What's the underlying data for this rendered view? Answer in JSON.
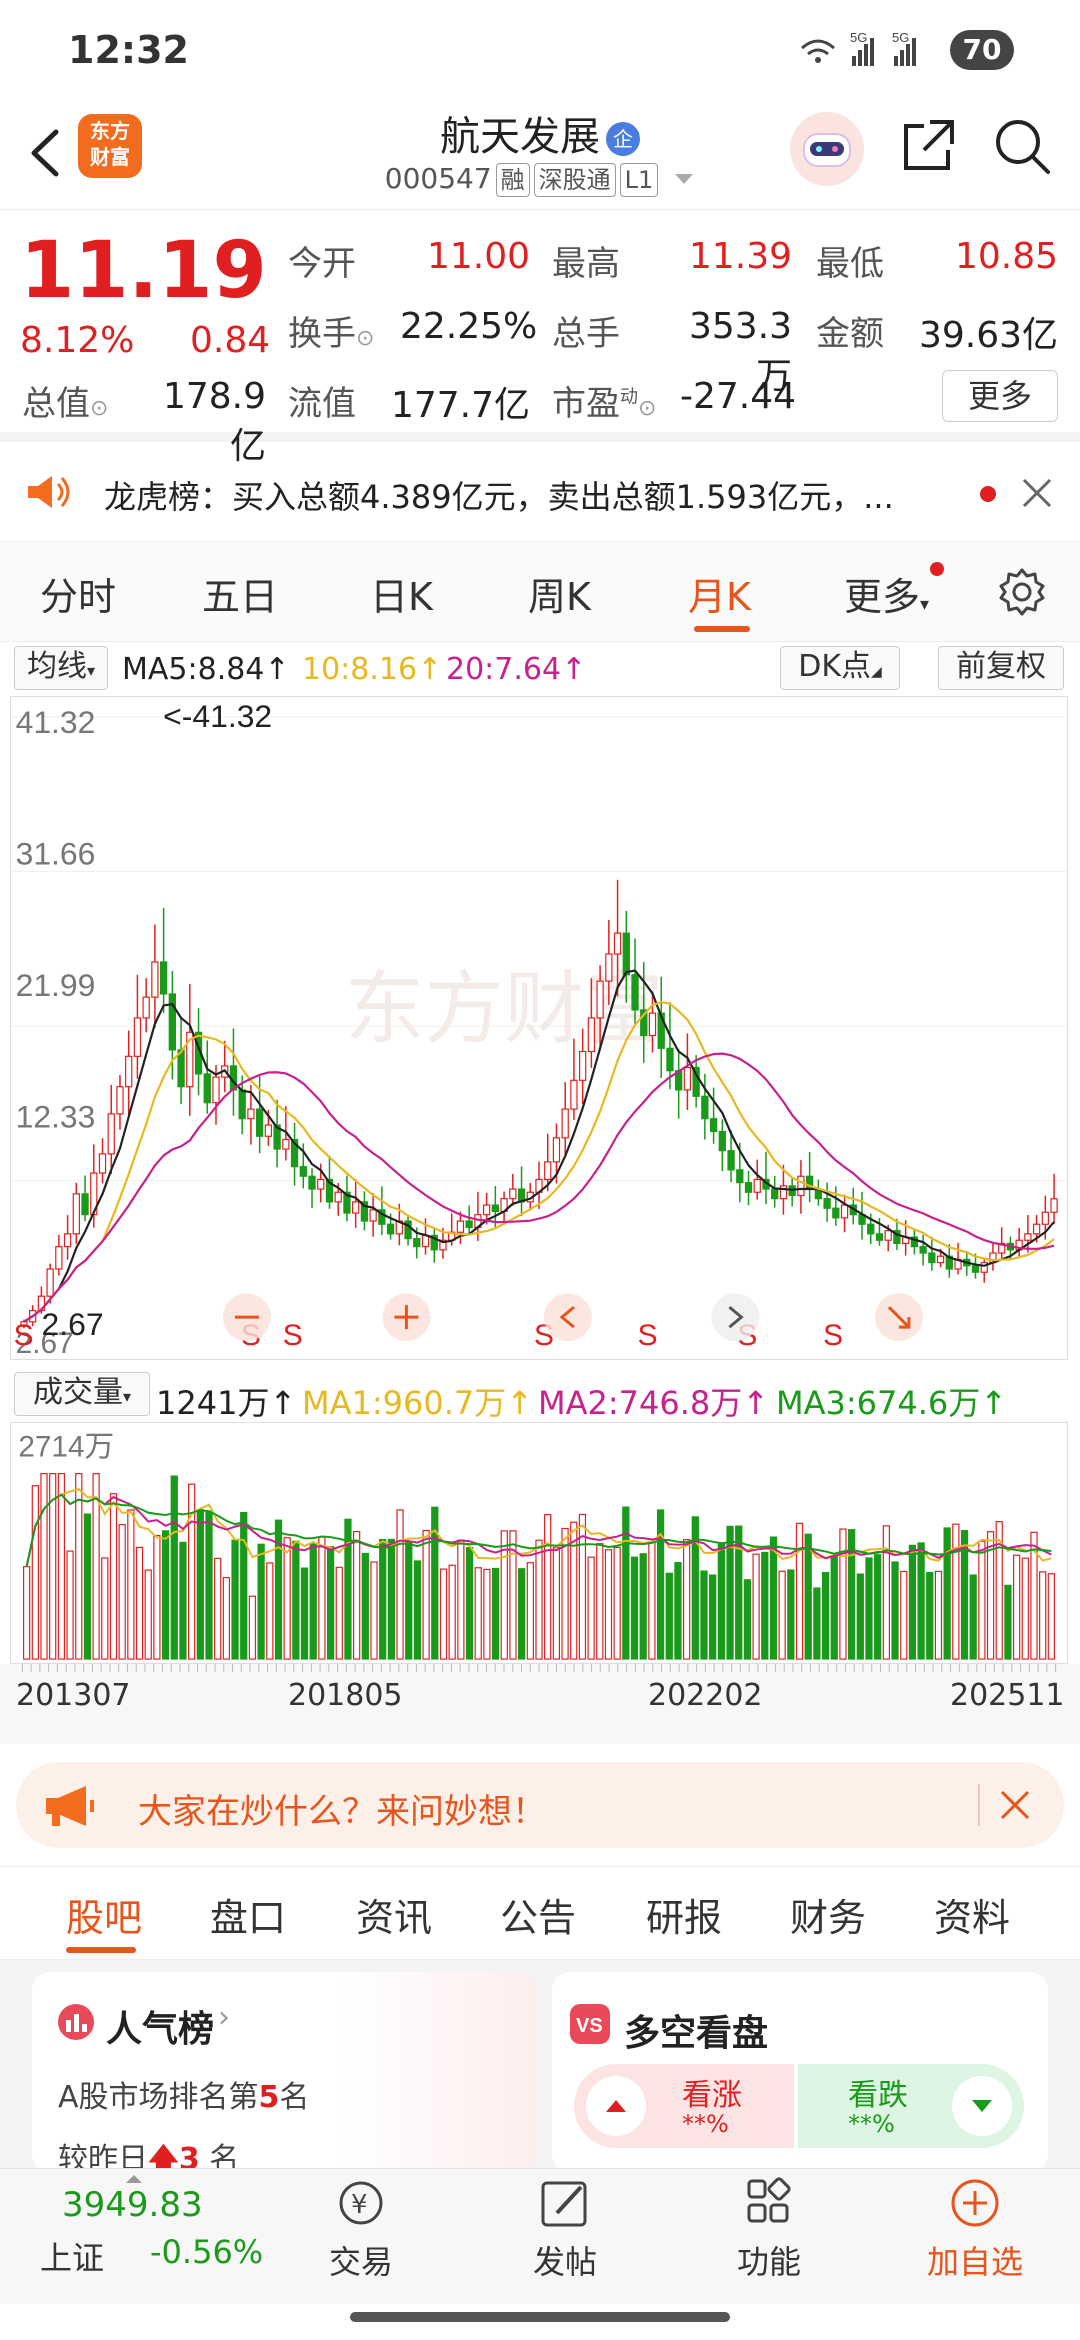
{
  "status_bar": {
    "time": "12:32",
    "signal": "5G",
    "battery": "70"
  },
  "header": {
    "stock_name": "航天发展",
    "name_badge": "企",
    "stock_code": "000547",
    "tags": [
      "融",
      "深股通",
      "L1"
    ],
    "logo_text": "东方财富"
  },
  "quote": {
    "price": "11.19",
    "change_pct": "8.12%",
    "change_amt": "0.84",
    "fields": [
      {
        "label": "今开",
        "value": "11.00",
        "color": "red"
      },
      {
        "label": "最高",
        "value": "11.39",
        "color": "red"
      },
      {
        "label": "最低",
        "value": "10.85",
        "color": "red"
      },
      {
        "label": "换手",
        "value": "22.25%",
        "color": "dark"
      },
      {
        "label": "总手",
        "value": "353.3万",
        "color": "dark"
      },
      {
        "label": "金额",
        "value": "39.63亿",
        "color": "dark"
      },
      {
        "label": "总值",
        "value": "178.9亿",
        "color": "dark"
      },
      {
        "label": "流值",
        "value": "177.7亿",
        "color": "dark"
      },
      {
        "label": "市盈",
        "value": "-27.44",
        "color": "dark"
      }
    ],
    "pe_superscript": "动",
    "more_label": "更多"
  },
  "notice": {
    "text": "龙虎榜：买入总额4.389亿元，卖出总额1.593亿元，..."
  },
  "period_tabs": [
    "分时",
    "五日",
    "日K",
    "周K",
    "月K",
    "更多"
  ],
  "active_period": "月K",
  "ma_row": {
    "indicator": "均线",
    "ma5": "MA5:8.84",
    "ma10": "10:8.16",
    "ma20": "20:7.64",
    "arrow": "↑",
    "dk_label": "DK点",
    "adjust_label": "前复权"
  },
  "kchart": {
    "y_labels": [
      "41.32",
      "31.66",
      "21.99",
      "12.33",
      "2.67"
    ],
    "max_marker": "<-41.32",
    "min_marker": "2.67",
    "signal_marks": [
      "S",
      "S",
      "S",
      "S",
      "S",
      "S",
      "S"
    ],
    "watermark": "东方财富"
  },
  "volume": {
    "label": "成交量",
    "current": "1241万",
    "ma1": "MA1:960.7万",
    "ma2": "MA2:746.8万",
    "ma3": "MA3:674.6万",
    "arrow": "↑",
    "max_label": "2714万"
  },
  "x_axis": [
    "201307",
    "201805",
    "202202",
    "202511"
  ],
  "banner": {
    "text": "大家在炒什么？来问妙想！"
  },
  "section_tabs": [
    "股吧",
    "盘口",
    "资讯",
    "公告",
    "研报",
    "财务",
    "资料"
  ],
  "active_section": "股吧",
  "popularity": {
    "title": "人气榜",
    "rank_prefix": "A股市场排名第",
    "rank": "5",
    "rank_suffix": "名",
    "change_prefix": "较昨日",
    "change": "3",
    "change_suffix": "名"
  },
  "long_short": {
    "title": "多空看盘",
    "bull_label": "看涨",
    "bull_value": "**%",
    "bear_label": "看跌",
    "bear_value": "**%"
  },
  "bottom_nav": {
    "index_value": "3949.83",
    "index_name": "上证",
    "index_change": "-0.56%",
    "items": [
      "交易",
      "发帖",
      "功能",
      "加自选"
    ]
  },
  "colors": {
    "up": "#e02020",
    "down": "#1a9a1a",
    "accent": "#e8541c",
    "ma5": "#222222",
    "ma10": "#e8b820",
    "ma20": "#c8208c"
  },
  "chart_data": {
    "type": "candlestick",
    "period": "monthly",
    "x_range": [
      "201307",
      "202511"
    ],
    "y_range": [
      2.67,
      41.32
    ],
    "y_ticks": [
      41.32,
      31.66,
      21.99,
      12.33,
      2.67
    ],
    "ma_lines": [
      {
        "name": "MA5",
        "value": 8.84
      },
      {
        "name": "MA10",
        "value": 8.16
      },
      {
        "name": "MA20",
        "value": 7.64
      }
    ],
    "close_approx": [
      3.5,
      4.2,
      5.1,
      6.8,
      8.2,
      9.0,
      11.5,
      10.2,
      12.8,
      14.0,
      16.5,
      18.2,
      20.1,
      22.5,
      23.8,
      26.0,
      24.0,
      20.5,
      18.2,
      21.6,
      19.0,
      17.2,
      18.8,
      19.5,
      18.0,
      16.2,
      16.8,
      15.1,
      15.8,
      14.3,
      14.9,
      13.2,
      12.6,
      11.8,
      12.4,
      11.0,
      11.6,
      10.3,
      11.0,
      9.8,
      10.5,
      9.6,
      9.0,
      9.8,
      8.7,
      8.2,
      8.9,
      8.0,
      8.6,
      9.1,
      9.8,
      9.4,
      10.2,
      10.8,
      10.4,
      11.2,
      11.8,
      11.0,
      11.6,
      12.4,
      13.5,
      15.0,
      16.8,
      18.6,
      20.4,
      22.5,
      24.8,
      26.5,
      27.8,
      25.2,
      23.0,
      21.4,
      22.8,
      20.6,
      19.2,
      18.0,
      19.4,
      17.6,
      16.2,
      15.4,
      14.2,
      13.0,
      12.2,
      11.6,
      12.4,
      11.8,
      11.2,
      12.0,
      11.4,
      12.6,
      11.8,
      11.2,
      10.6,
      10.0,
      10.8,
      10.2,
      9.6,
      9.0,
      8.6,
      9.2,
      8.4,
      8.8,
      8.2,
      7.8,
      7.2,
      7.6,
      6.8,
      7.4,
      7.0,
      6.6,
      7.2,
      7.8,
      8.4,
      8.0,
      8.6,
      9.0,
      9.6,
      10.35,
      11.19
    ],
    "volume_ticks": [
      "2714万"
    ],
    "volume_current": "1241万"
  }
}
